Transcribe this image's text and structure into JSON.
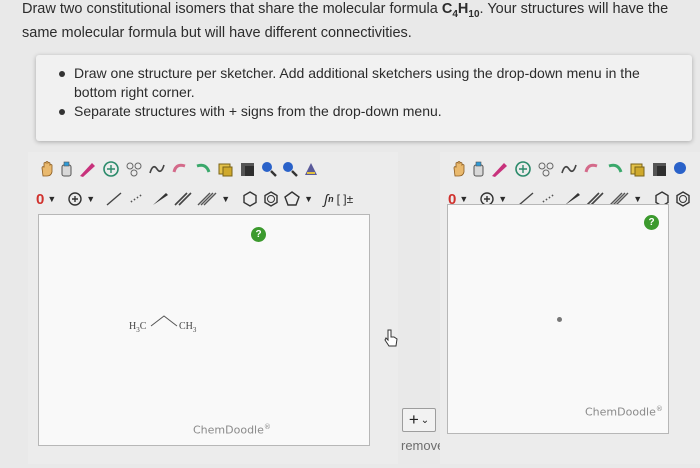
{
  "question": {
    "text_before": "Draw two constitutional isomers that share the molecular formula ",
    "formula_c": "C",
    "formula_c_sub": "4",
    "formula_h": "H",
    "formula_h_sub": "10",
    "text_after": ". Your structures will have the same molecular formula but will have different connectivities."
  },
  "instructions": [
    "Draw one structure per sketcher. Add additional sketchers using the drop-down menu in the bottom right corner.",
    "Separate structures with + signs from the drop-down menu."
  ],
  "sketcher1": {
    "charge_label": "0",
    "molecule_left": "H",
    "molecule_left_sub": "3",
    "molecule_left_c": "C",
    "molecule_right": "CH",
    "molecule_right_sub": "3",
    "help_label": "?",
    "watermark": "ChemDoodle",
    "bracket_label": "[ ]±",
    "sn_label": "n"
  },
  "sketcher2": {
    "charge_label": "0",
    "help_label": "?",
    "watermark": "ChemDoodle"
  },
  "controls": {
    "plus_label": "+",
    "plus_chevron": "⌄",
    "remove_label": "remove"
  },
  "colors": {
    "help_green": "#3c9a2e",
    "charge_red": "#d0312d",
    "accent_blue": "#2a62c9"
  }
}
